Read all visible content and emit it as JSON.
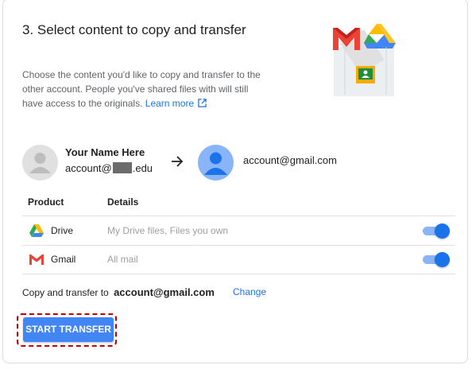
{
  "section": {
    "title": "3. Select content to copy and transfer",
    "description": "Choose the content you'd like to copy and transfer to the other account. People you've shared files with will still have access to the originals.",
    "learn_more": "Learn more"
  },
  "source": {
    "name": "Your Name Here",
    "email_prefix": "account@",
    "email_suffix": ".edu"
  },
  "destination": {
    "email": "account@gmail.com"
  },
  "table": {
    "headers": [
      "Product",
      "Details"
    ],
    "rows": [
      {
        "product": "Drive",
        "details": "My Drive files, Files you own",
        "icon": "google-drive-icon",
        "enabled": true
      },
      {
        "product": "Gmail",
        "details": "All mail",
        "icon": "gmail-icon",
        "enabled": true
      }
    ]
  },
  "copy_to": {
    "label": "Copy and transfer to",
    "email": "account@gmail.com",
    "change_label": "Change"
  },
  "start_button": "START TRANSFER",
  "colors": {
    "accent": "#1a73e8",
    "button": "#4285f4",
    "highlight_outline": "#c00000",
    "toggle_track": "#8ab4f8"
  }
}
